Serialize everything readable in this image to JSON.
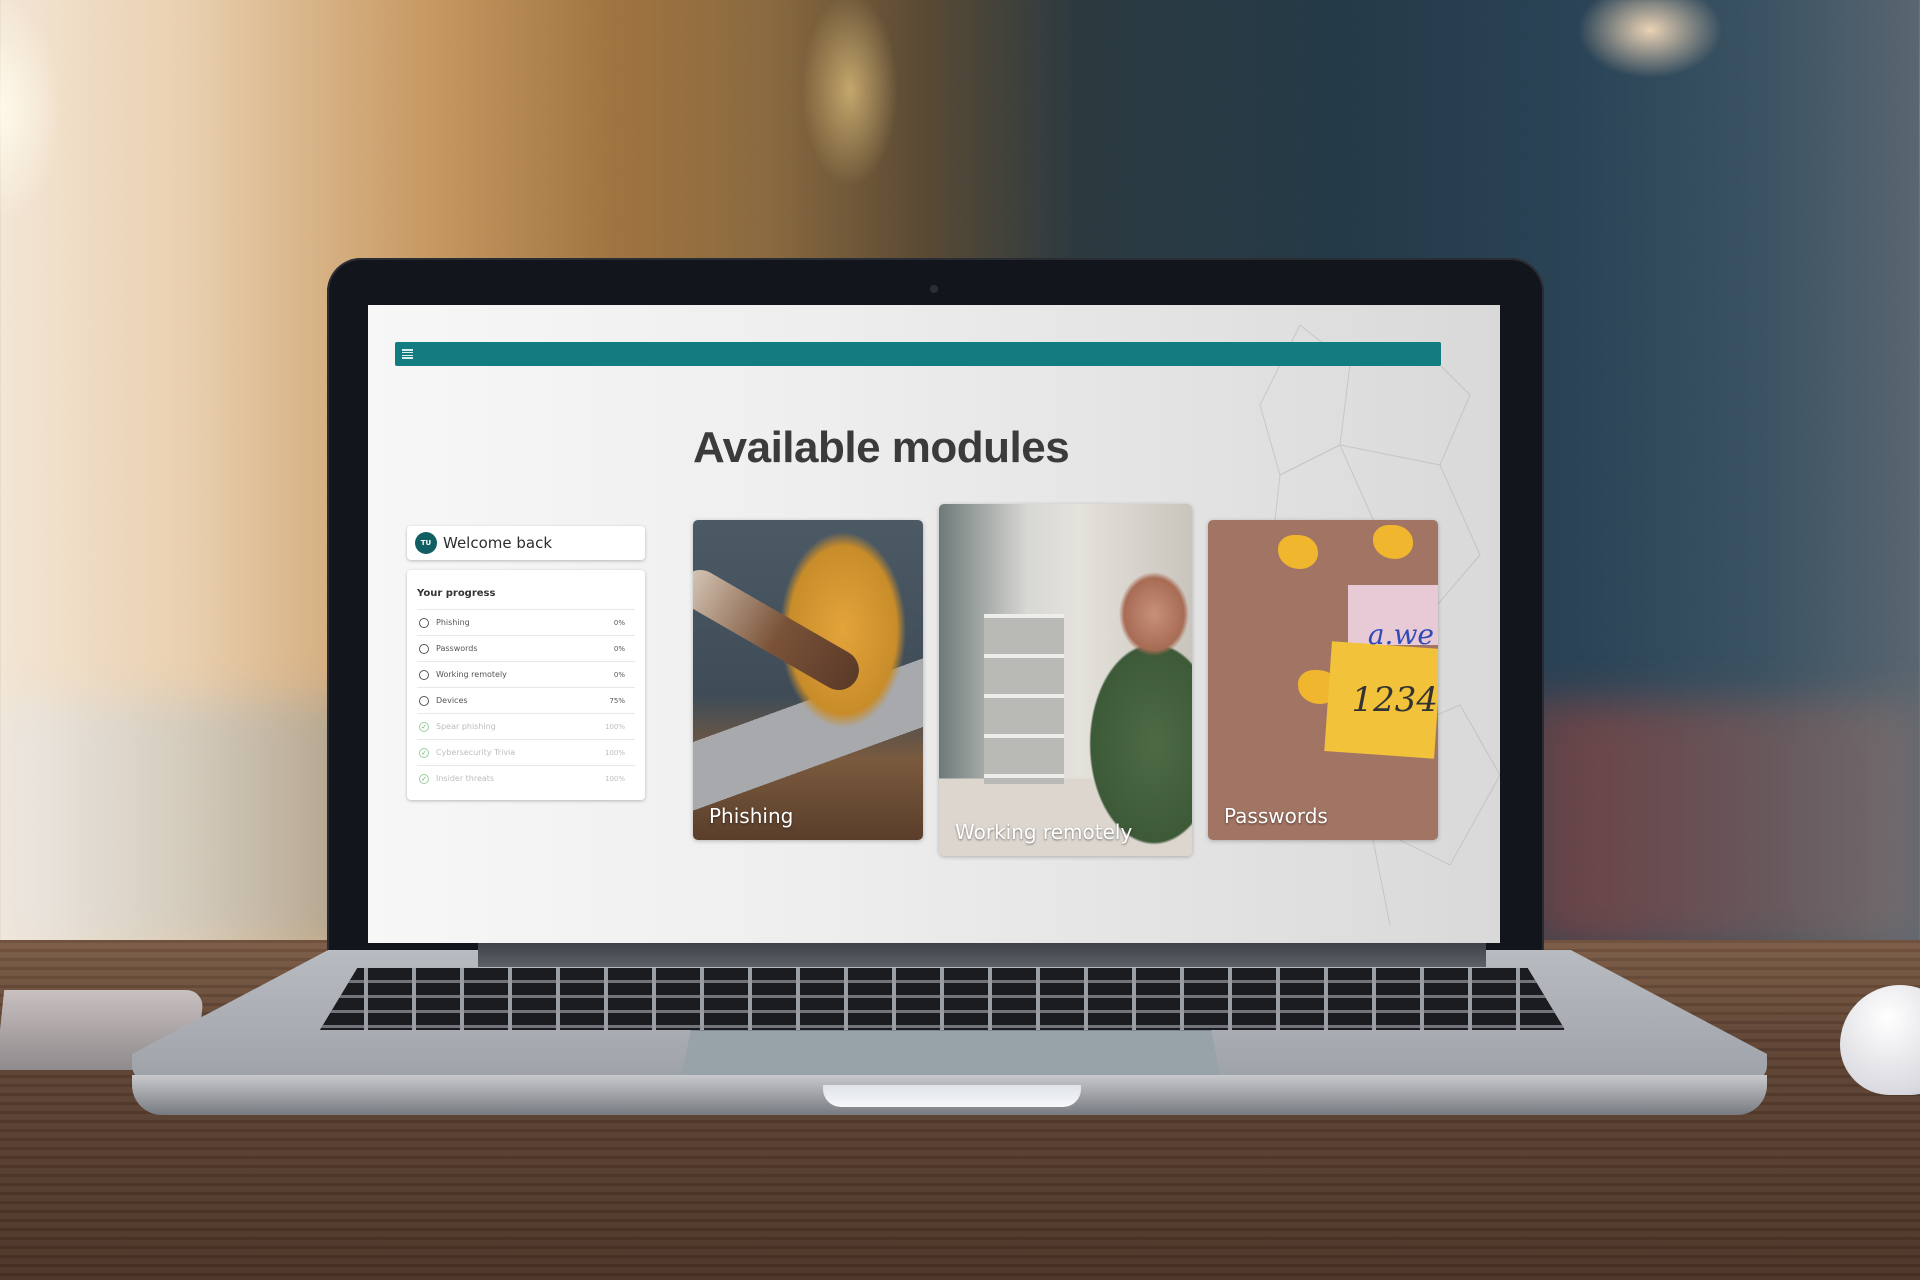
{
  "app": {
    "menu_icon": "hamburger-menu-icon",
    "brand_color": "#137c80"
  },
  "page": {
    "title": "Available modules"
  },
  "welcome": {
    "avatar_initials": "TU",
    "text": "Welcome back"
  },
  "progress": {
    "title": "Your progress",
    "items": [
      {
        "label": "Phishing",
        "percent": "0%",
        "status": "incomplete",
        "icon": "empty-circle-icon"
      },
      {
        "label": "Passwords",
        "percent": "0%",
        "status": "incomplete",
        "icon": "empty-circle-icon"
      },
      {
        "label": "Working remotely",
        "percent": "0%",
        "status": "incomplete",
        "icon": "empty-circle-icon"
      },
      {
        "label": "Devices",
        "percent": "75%",
        "status": "incomplete",
        "icon": "empty-circle-icon"
      },
      {
        "label": "Spear phishing",
        "percent": "100%",
        "status": "complete",
        "icon": "check-circle-icon"
      },
      {
        "label": "Cybersecurity Trivia",
        "percent": "100%",
        "status": "complete",
        "icon": "check-circle-icon"
      },
      {
        "label": "Insider threats",
        "percent": "100%",
        "status": "complete",
        "icon": "check-circle-icon"
      }
    ]
  },
  "modules": [
    {
      "label": "Phishing"
    },
    {
      "label": "Working remotely"
    },
    {
      "label": "Passwords"
    }
  ],
  "passwords_card": {
    "note_line1": "a.we",
    "note_line2": "1234"
  },
  "colors": {
    "complete_check": "#6ab06e",
    "avatar_bg": "#125f63"
  }
}
